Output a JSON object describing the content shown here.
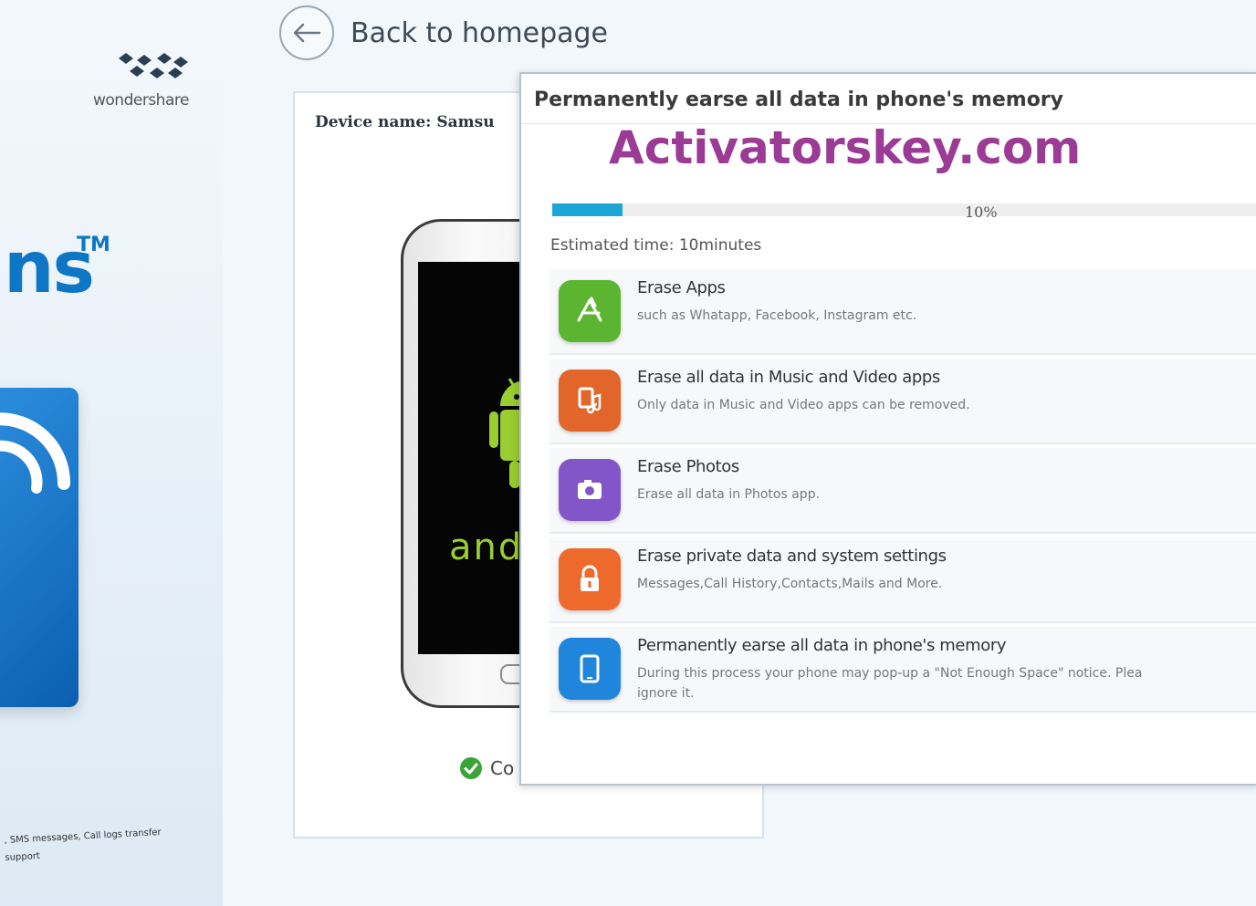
{
  "product_box": {
    "brand": "wondershare",
    "title_fragment": "ns",
    "trademark": "TM",
    "tagline_lines": [
      ", SMS messages, Call logs transfer",
      "support"
    ]
  },
  "header": {
    "back_label": "Back to homepage"
  },
  "device_panel": {
    "device_name": "Device name: Samsu",
    "android_word": "and",
    "status_label": "Co",
    "status_color": "#3aa43a"
  },
  "dialog": {
    "title": "Permanently earse all data in phone's memory",
    "watermark": "Activatorskey.com",
    "progress": {
      "percent_label": "10%",
      "value": 10
    },
    "estimated_time": "Estimated time: 10minutes",
    "accent_color": "#1ba6d8",
    "tasks": [
      {
        "icon": "appstore-icon",
        "color": "#5cb531",
        "title": "Erase Apps",
        "desc": "such as Whatapp, Facebook, Instagram etc."
      },
      {
        "icon": "music-video-icon",
        "color": "#e2662a",
        "title": "Erase all data in Music and Video apps",
        "desc": "Only data in Music and Video apps can be removed."
      },
      {
        "icon": "camera-icon",
        "color": "#8256c9",
        "title": "Erase Photos",
        "desc": "Erase all data in Photos app."
      },
      {
        "icon": "lock-icon",
        "color": "#ee6a2c",
        "title": "Erase private data and system settings",
        "desc": "Messages,Call History,Contacts,Mails and More."
      },
      {
        "icon": "phone-icon",
        "color": "#1f86db",
        "title": "Permanently earse all data in phone's memory",
        "desc": "During this process your phone may pop-up a \"Not Enough Space\" notice. Plea",
        "desc2": "ignore it."
      }
    ]
  }
}
